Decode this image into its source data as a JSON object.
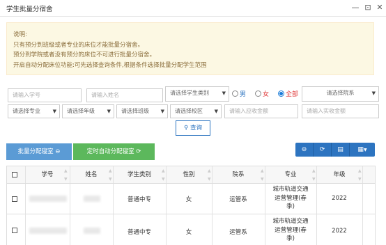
{
  "window": {
    "title": "学生批量分宿舍",
    "minimize": "—",
    "maximize": "⊡",
    "close": "✕"
  },
  "notice": {
    "title": "说明:",
    "lines": [
      "只有预分到班级或者专业的床位才能批量分宿舍。",
      "预分到学院或者没有预分的床位不可进行批量分宿舍。",
      "开启自动分配床位功能:可先选择查询条件,根据条件选择批量分配学生范围"
    ]
  },
  "filters": {
    "student_no_placeholder": "请输入学号",
    "name_placeholder": "请输入姓名",
    "student_type": "请选择学生类别",
    "gender_options": [
      "男",
      "女",
      "全部"
    ],
    "gender_selected": "全部",
    "department": "请选择院系",
    "major": "请选择专业",
    "grade": "请选择年级",
    "class": "请选择班级",
    "campus": "请选择校区",
    "receivable_placeholder": "请输入应收金额",
    "actual_placeholder": "请输入实收金额",
    "search_label": "查询"
  },
  "actions": {
    "batch_assign_label": "批量分配寝室",
    "auto_assign_label": "定时自动分配寝室"
  },
  "table": {
    "columns": [
      "学号",
      "姓名",
      "学生类别",
      "性别",
      "院系",
      "专业",
      "年级"
    ],
    "rows": [
      {
        "student_type": "普通中专",
        "gender": "女",
        "department": "运管系",
        "major": [
          "城市轨道交通",
          "运营管理(春",
          "季)"
        ],
        "grade": "2022"
      },
      {
        "student_type": "普通中专",
        "gender": "女",
        "department": "运管系",
        "major": [
          "城市轨道交通",
          "运营管理(春",
          "季)"
        ],
        "grade": "2022"
      }
    ]
  },
  "colors": {
    "notice_bg": "#fcf8e3",
    "notice_text": "#8a6d3b",
    "primary": "#2d74c0",
    "batch_btn": "#5b9bd5",
    "auto_btn": "#5cb85c",
    "female": "#e03a3a",
    "radio_active": "#1a7cd8"
  }
}
